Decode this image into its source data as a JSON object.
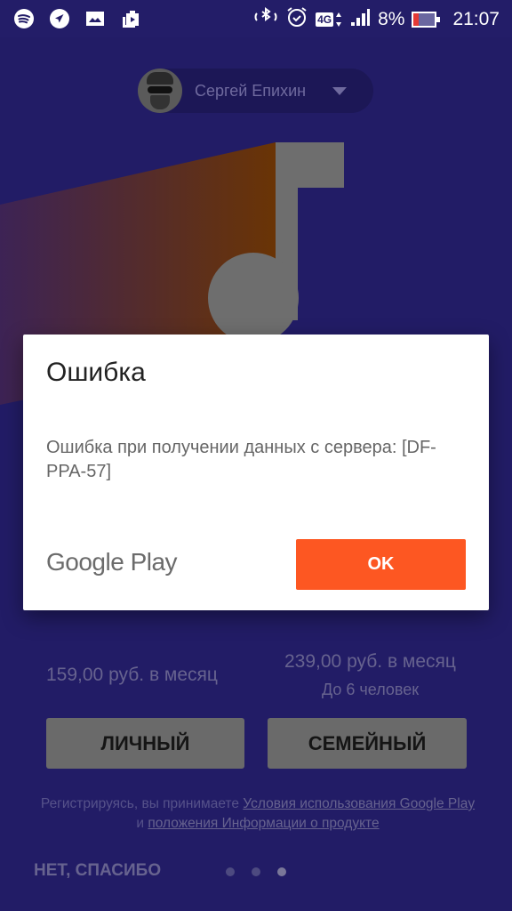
{
  "status_bar": {
    "left_icons": [
      "spotify-icon",
      "telegram-icon",
      "gallery-icon",
      "media-icon"
    ],
    "right_icons": [
      "bluetooth-icon",
      "alarm-icon",
      "network-4g-icon",
      "signal-icon"
    ],
    "network_label": "4G",
    "battery_percent": "8%",
    "battery_level": 0.08,
    "time": "21:07"
  },
  "account": {
    "name": "Сергей Епихин"
  },
  "dialog": {
    "title": "Ошибка",
    "message": "Ошибка при получении данных с сервера: [DF-PPA-57]",
    "brand": "Google Play",
    "ok_label": "OK",
    "accent_color": "#fd5722"
  },
  "plans": {
    "personal": {
      "price": "159,00 руб. в месяц",
      "button": "ЛИЧНЫЙ"
    },
    "family": {
      "price": "239,00 руб. в месяц",
      "note": "До 6 человек",
      "button": "СЕМЕЙНЫЙ"
    }
  },
  "terms": {
    "prefix": "Регистрируясь, вы принимаете ",
    "link1": "Условия использования Google Play",
    "middle": " и ",
    "link2": "положения Информации о продукте"
  },
  "footer": {
    "no_thanks": "НЕТ, СПАСИБО",
    "page_count": 3,
    "active_page": 3
  }
}
